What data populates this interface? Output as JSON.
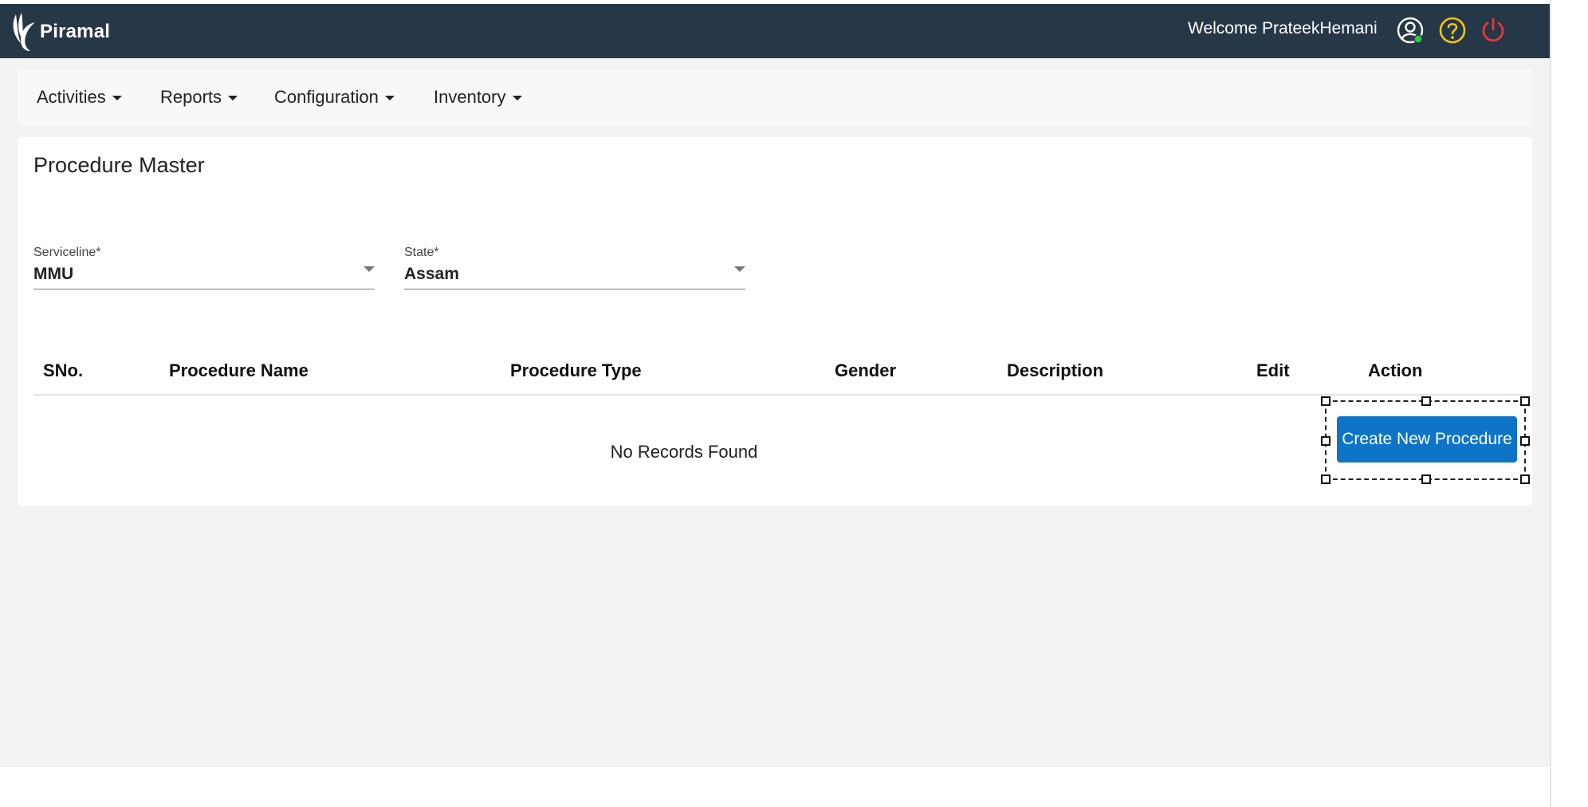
{
  "header": {
    "brand": "Piramal",
    "welcome": "Welcome PrateekHemani",
    "icons": [
      "user-profile-icon",
      "help-icon",
      "power-icon"
    ],
    "colors": {
      "bar": "#263747",
      "help": "#f5c518",
      "power": "#e53935",
      "online_dot": "#2ecc40"
    }
  },
  "nav": {
    "items": [
      "Activities",
      "Reports",
      "Configuration",
      "Inventory"
    ]
  },
  "page": {
    "title": "Procedure Master"
  },
  "filters": {
    "serviceline": {
      "label": "Serviceline*",
      "value": "MMU"
    },
    "state": {
      "label": "State*",
      "value": "Assam"
    }
  },
  "table": {
    "columns": [
      "SNo.",
      "Procedure Name",
      "Procedure Type",
      "Gender",
      "Description",
      "Edit",
      "Action"
    ],
    "empty_message": "No Records Found"
  },
  "actions": {
    "create_label": "Create New Procedure",
    "create_color": "#0e74c8"
  }
}
